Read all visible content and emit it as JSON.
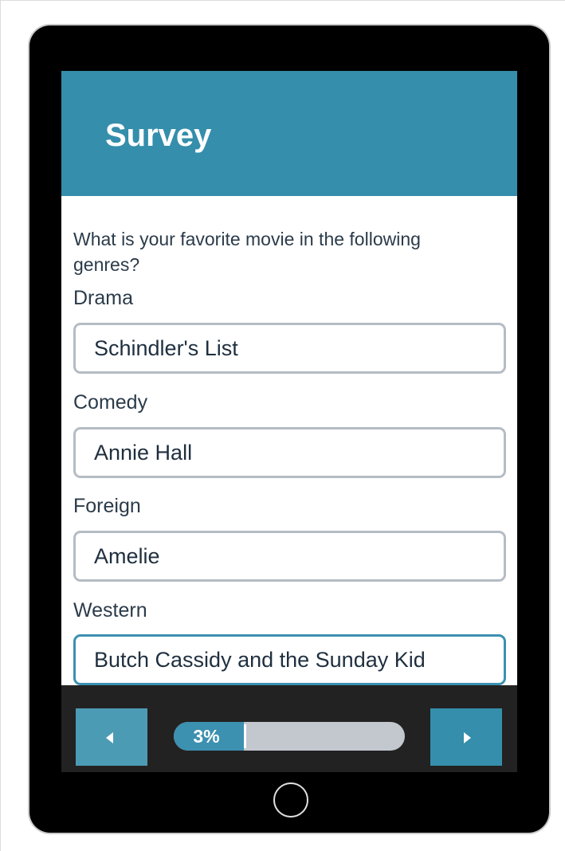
{
  "survey": {
    "title": "Survey",
    "question": "What is your favorite movie in the following genres?",
    "fields": [
      {
        "label": "Drama",
        "value": "Schindler's List"
      },
      {
        "label": "Comedy",
        "value": "Annie Hall"
      },
      {
        "label": "Foreign",
        "value": "Amelie"
      },
      {
        "label": "Western",
        "value": "Butch Cassidy and the Sunday Kid"
      }
    ]
  },
  "progress": {
    "percent_label": "3%",
    "value": 0.03
  },
  "icons": {
    "prev": "caret-left-icon",
    "next": "caret-right-icon",
    "home": "home-button-circle"
  },
  "colors": {
    "header": "#358eab",
    "accent": "#3c90b0",
    "footer": "#222222",
    "text": "#2b3b4a"
  }
}
